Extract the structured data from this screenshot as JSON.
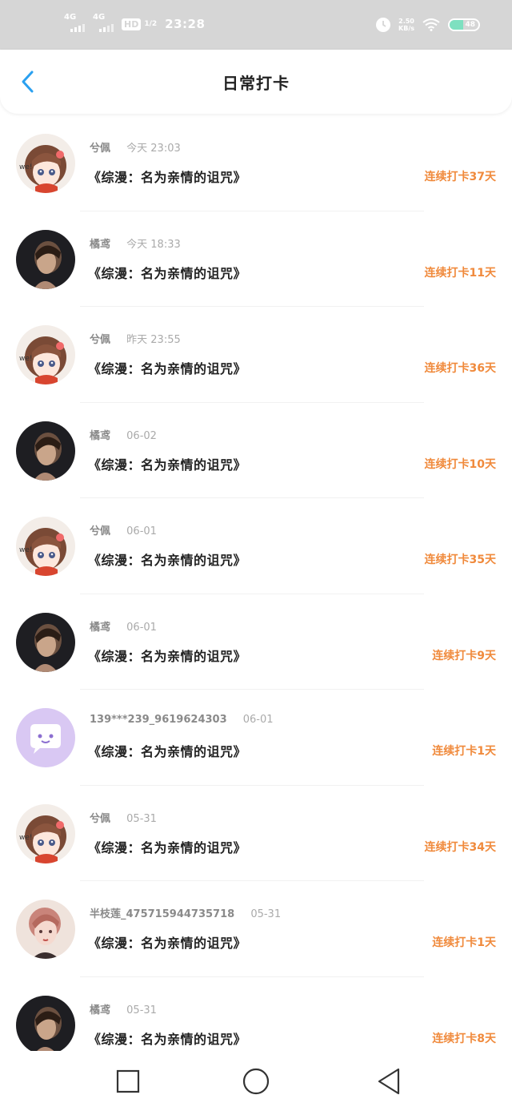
{
  "status_bar": {
    "signal1": "4G",
    "signal2": "4G",
    "hd_badge": "HD",
    "hd_slot": "1/2",
    "time": "23:28",
    "net_speed_value": "2.50",
    "net_speed_unit": "KB/s",
    "battery_text": "48",
    "battery_level": 0.48
  },
  "header": {
    "back_icon": "chevron-left-icon",
    "title": "日常打卡"
  },
  "colors": {
    "accent_blue": "#2aa0f0",
    "streak_orange": "#f08a3c"
  },
  "checkins": [
    {
      "avatar": "anime-girl-avatar",
      "name": "兮佩",
      "time": "今天 23:03",
      "book": "《综漫：名为亲情的诅咒》",
      "streak": "连续打卡37天"
    },
    {
      "avatar": "dark-portrait-avatar",
      "name": "橘鸢",
      "time": "今天 18:33",
      "book": "《综漫：名为亲情的诅咒》",
      "streak": "连续打卡11天"
    },
    {
      "avatar": "anime-girl-avatar",
      "name": "兮佩",
      "time": "昨天 23:55",
      "book": "《综漫：名为亲情的诅咒》",
      "streak": "连续打卡36天"
    },
    {
      "avatar": "dark-portrait-avatar",
      "name": "橘鸢",
      "time": "06-02",
      "book": "《综漫：名为亲情的诅咒》",
      "streak": "连续打卡10天"
    },
    {
      "avatar": "anime-girl-avatar",
      "name": "兮佩",
      "time": "06-01",
      "book": "《综漫：名为亲情的诅咒》",
      "streak": "连续打卡35天"
    },
    {
      "avatar": "dark-portrait-avatar",
      "name": "橘鸢",
      "time": "06-01",
      "book": "《综漫：名为亲情的诅咒》",
      "streak": "连续打卡9天"
    },
    {
      "avatar": "chat-bubble-avatar",
      "name": "139***239_9619624303",
      "time": "06-01",
      "book": "《综漫：名为亲情的诅咒》",
      "streak": "连续打卡1天"
    },
    {
      "avatar": "anime-girl-avatar",
      "name": "兮佩",
      "time": "05-31",
      "book": "《综漫：名为亲情的诅咒》",
      "streak": "连续打卡34天"
    },
    {
      "avatar": "painted-girl-avatar",
      "name": "半枝莲_475715944735718",
      "time": "05-31",
      "book": "《综漫：名为亲情的诅咒》",
      "streak": "连续打卡1天"
    },
    {
      "avatar": "dark-portrait-avatar",
      "name": "橘鸢",
      "time": "05-31",
      "book": "《综漫：名为亲情的诅咒》",
      "streak": "连续打卡8天"
    }
  ],
  "nav": {
    "recent_icon": "square-recents-icon",
    "home_icon": "circle-home-icon",
    "back_icon": "triangle-back-icon"
  }
}
